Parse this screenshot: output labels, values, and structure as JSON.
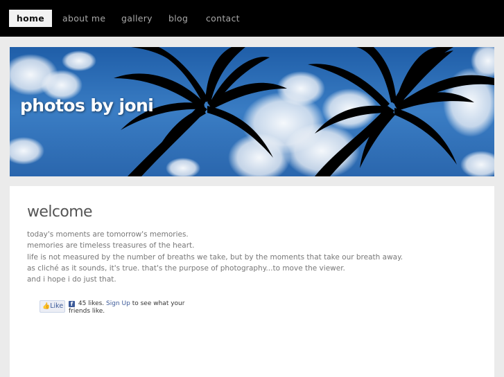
{
  "nav": {
    "items": [
      {
        "label": "home",
        "active": true
      },
      {
        "label": "about me",
        "active": false
      },
      {
        "label": "gallery",
        "active": false
      },
      {
        "label": "blog",
        "active": false
      },
      {
        "label": "contact",
        "active": false
      }
    ]
  },
  "banner": {
    "title": "photos by joni"
  },
  "main": {
    "heading": "welcome",
    "lines": [
      "today's moments are tomorrow's memories.",
      "memories are timeless treasures of the heart.",
      "life is not measured by the number of breaths we take, but by the moments that take our breath away.",
      "as cliché as it sounds, it's true. that's the purpose of photography...to move the viewer.",
      "and i hope i do just that."
    ]
  },
  "facebook": {
    "like_label": "Like",
    "likes_text": "45 likes.",
    "signup_label": "Sign Up",
    "suffix_text": "to see what your friends like."
  },
  "colors": {
    "nav_bg": "#000000",
    "page_bg": "#ebebeb",
    "fb_blue": "#3b5998"
  }
}
